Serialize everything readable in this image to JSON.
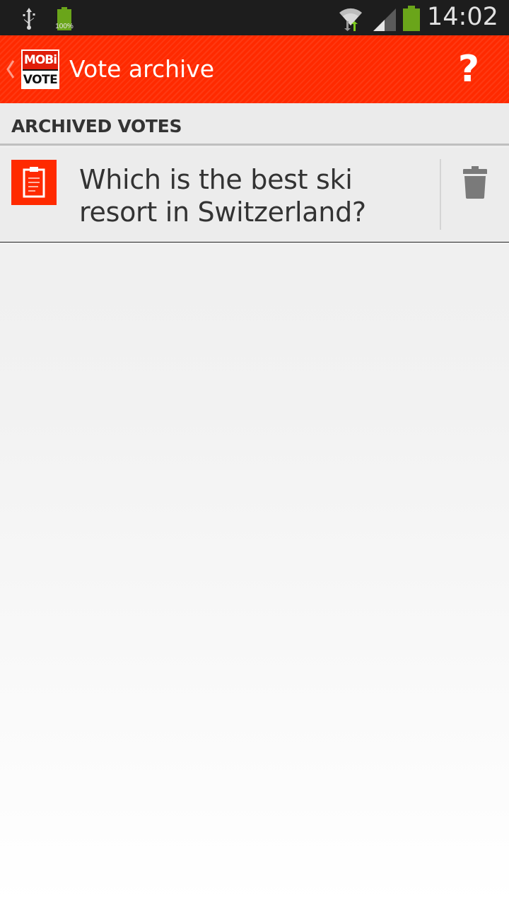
{
  "status_bar": {
    "battery_small_label": "100%",
    "clock": "14:02",
    "icons": [
      "usb-icon",
      "battery-charging-icon",
      "wifi-icon",
      "signal-icon",
      "battery-icon"
    ],
    "battery_color": "#6aa51a"
  },
  "action_bar": {
    "logo_top": "MOBi",
    "logo_bottom": "VOTE",
    "title": "Vote archive",
    "help_label": "?",
    "accent_color": "#ff2a00"
  },
  "section": {
    "header": "ARCHIVED VOTES"
  },
  "votes": [
    {
      "question": "Which is the best ski resort in Switzerland?",
      "icon": "clipboard-icon",
      "action_icon": "trash-icon"
    }
  ]
}
